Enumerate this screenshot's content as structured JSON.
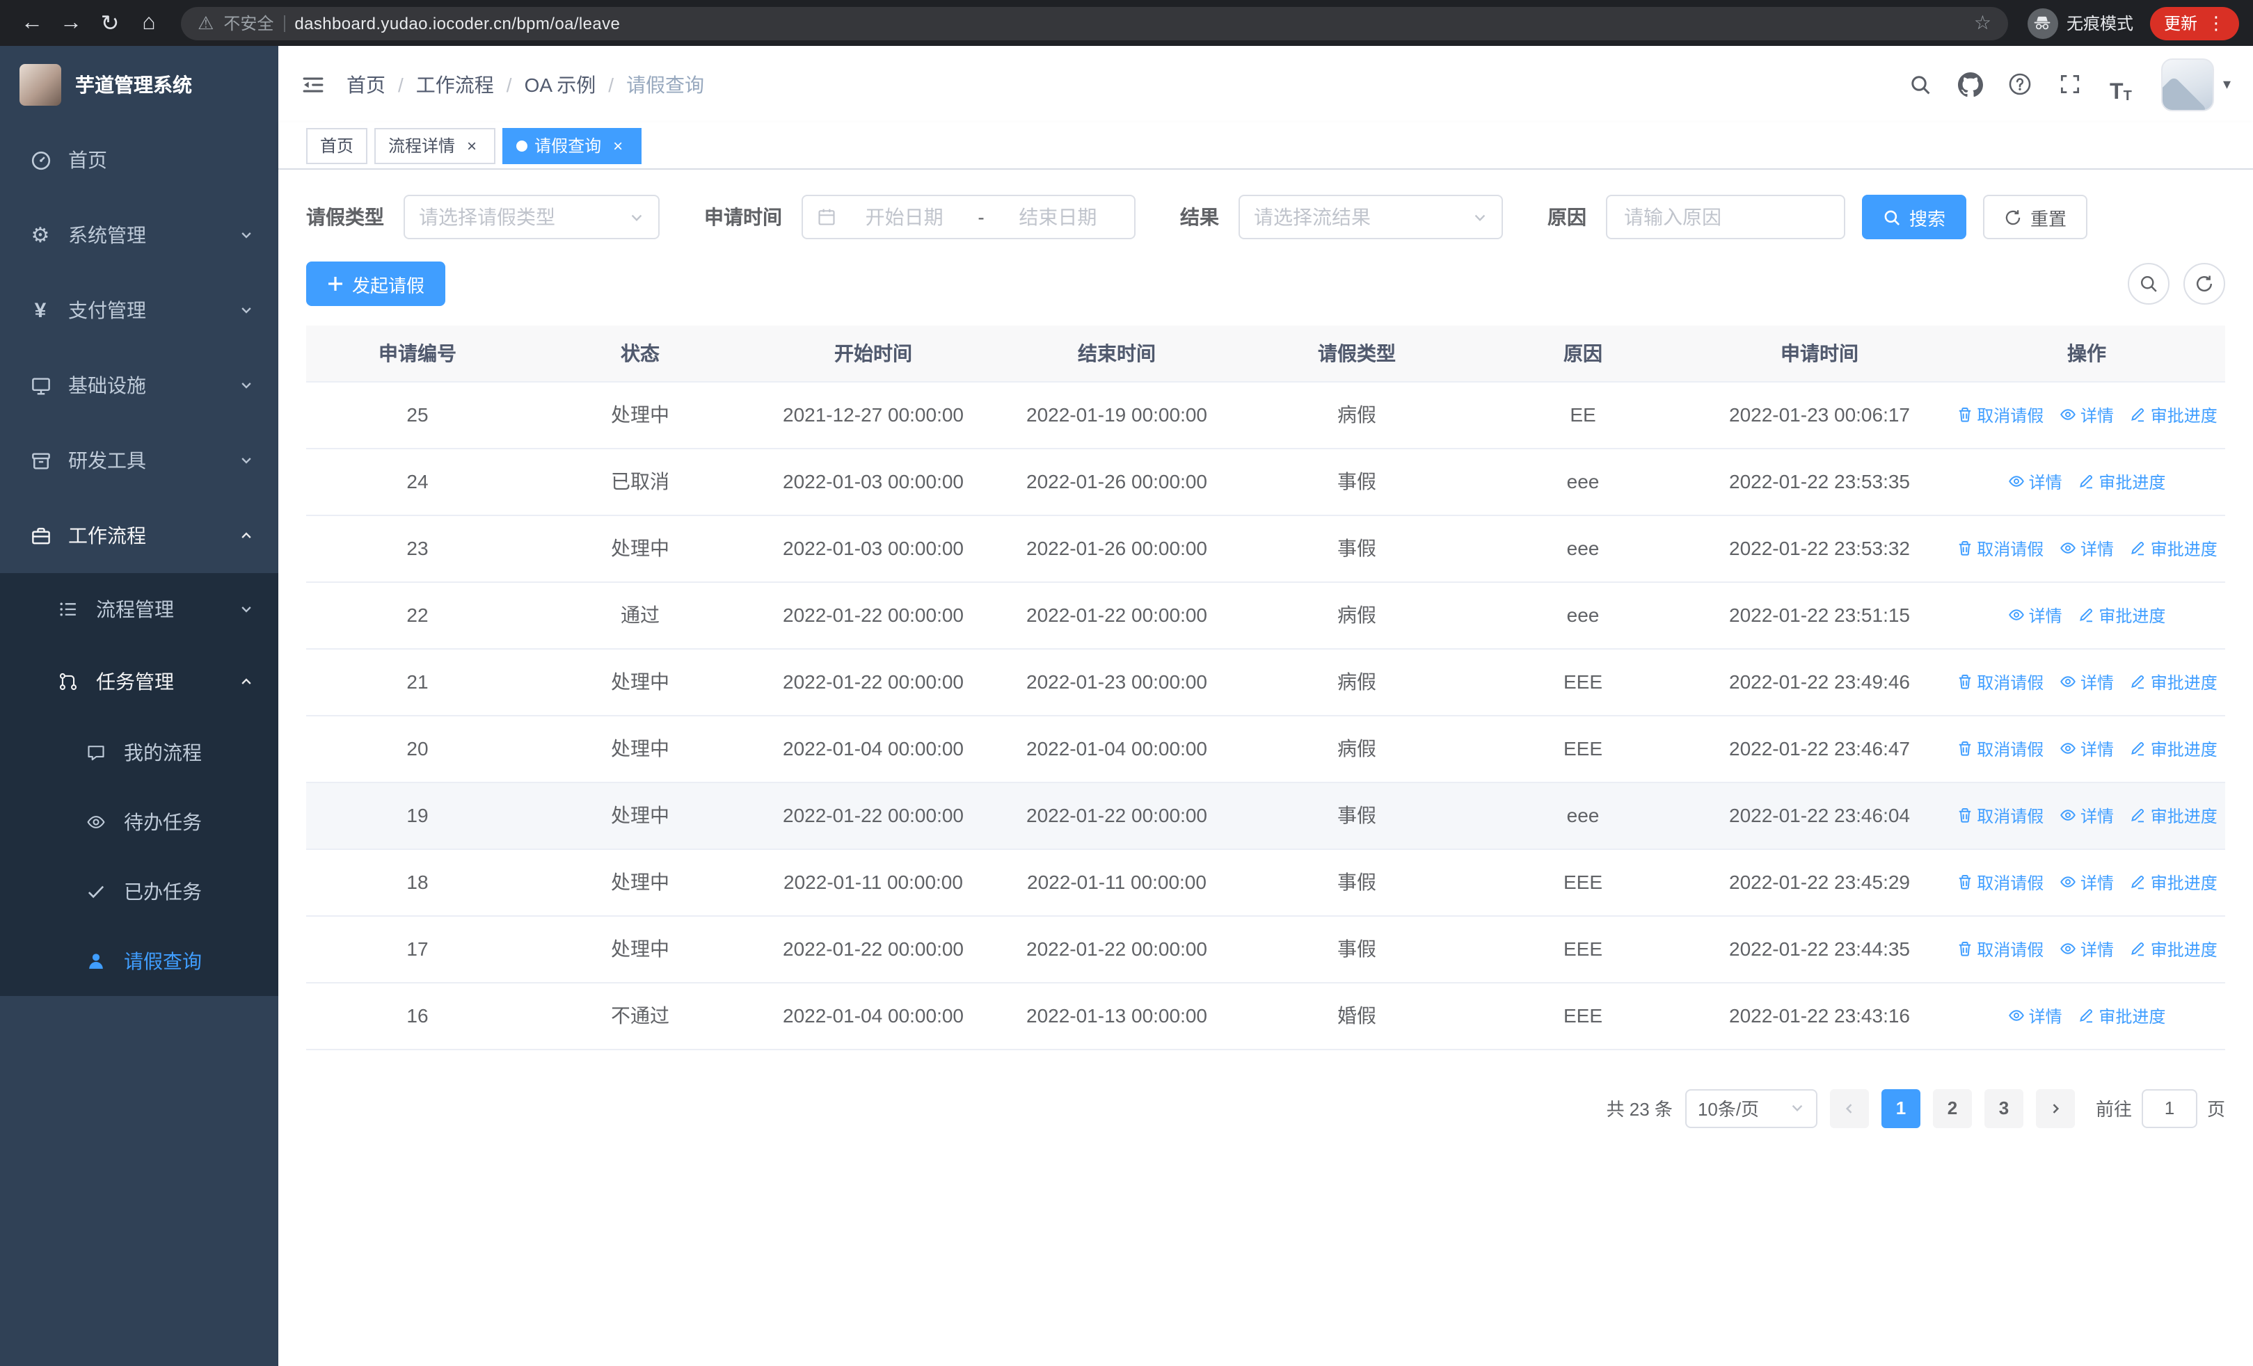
{
  "colors": {
    "primary": "#409eff",
    "sidebar_bg": "#304156",
    "submenu_bg": "#1f2d3d",
    "update_pill": "#d93025",
    "table_header_bg": "#f8f8f9"
  },
  "browser": {
    "nav_icons": [
      "back-icon",
      "forward-icon",
      "refresh-icon",
      "home-icon"
    ],
    "security_label": "不安全",
    "url": "dashboard.yudao.iocoder.cn/bpm/oa/leave",
    "incognito_label": "无痕模式",
    "update_label": "更新"
  },
  "sidebar": {
    "app_title": "芋道管理系统",
    "menu": [
      {
        "label": "首页",
        "icon": "dashboard-icon"
      },
      {
        "label": "系统管理",
        "icon": "gear-icon"
      },
      {
        "label": "支付管理",
        "icon": "payment-icon"
      },
      {
        "label": "基础设施",
        "icon": "infrastructure-icon"
      },
      {
        "label": "研发工具",
        "icon": "devtools-icon"
      },
      {
        "label": "工作流程",
        "icon": "workflow-icon"
      }
    ],
    "workflow_submenu": [
      {
        "label": "流程管理",
        "icon": "process-icon"
      },
      {
        "label": "任务管理",
        "icon": "tasks-icon"
      }
    ],
    "task_submenu": [
      {
        "label": "我的流程",
        "icon": "my-process-icon"
      },
      {
        "label": "待办任务",
        "icon": "todo-icon"
      },
      {
        "label": "已办任务",
        "icon": "done-icon"
      },
      {
        "label": "请假查询",
        "icon": "leave-query-icon"
      }
    ]
  },
  "header": {
    "breadcrumb": [
      "首页",
      "工作流程",
      "OA 示例",
      "请假查询"
    ],
    "right_icons": [
      "search-icon",
      "github-icon",
      "help-icon",
      "fullscreen-icon",
      "font-size-icon"
    ]
  },
  "tabs": [
    {
      "label": "首页",
      "closable": false,
      "active": false
    },
    {
      "label": "流程详情",
      "closable": true,
      "active": false
    },
    {
      "label": "请假查询",
      "closable": true,
      "active": true
    }
  ],
  "filters": {
    "leave_type_label": "请假类型",
    "leave_type_placeholder": "请选择请假类型",
    "apply_time_label": "申请时间",
    "date_start_placeholder": "开始日期",
    "date_separator": "-",
    "date_end_placeholder": "结束日期",
    "result_label": "结果",
    "result_placeholder": "请选择流结果",
    "reason_label": "原因",
    "reason_placeholder": "请输入原因",
    "search_label": "搜索",
    "reset_label": "重置"
  },
  "toolbar": {
    "create_label": "发起请假"
  },
  "table": {
    "columns": [
      "申请编号",
      "状态",
      "开始时间",
      "结束时间",
      "请假类型",
      "原因",
      "申请时间",
      "操作"
    ],
    "actions": {
      "cancel": "取消请假",
      "detail": "详情",
      "progress": "审批进度"
    },
    "rows": [
      {
        "id": "25",
        "status": "处理中",
        "start": "2021-12-27 00:00:00",
        "end": "2022-01-19 00:00:00",
        "type": "病假",
        "reason": "EE",
        "apply_time": "2022-01-23 00:06:17",
        "cancellable": true,
        "highlighted": false
      },
      {
        "id": "24",
        "status": "已取消",
        "start": "2022-01-03 00:00:00",
        "end": "2022-01-26 00:00:00",
        "type": "事假",
        "reason": "eee",
        "apply_time": "2022-01-22 23:53:35",
        "cancellable": false,
        "highlighted": false
      },
      {
        "id": "23",
        "status": "处理中",
        "start": "2022-01-03 00:00:00",
        "end": "2022-01-26 00:00:00",
        "type": "事假",
        "reason": "eee",
        "apply_time": "2022-01-22 23:53:32",
        "cancellable": true,
        "highlighted": false
      },
      {
        "id": "22",
        "status": "通过",
        "start": "2022-01-22 00:00:00",
        "end": "2022-01-22 00:00:00",
        "type": "病假",
        "reason": "eee",
        "apply_time": "2022-01-22 23:51:15",
        "cancellable": false,
        "highlighted": false
      },
      {
        "id": "21",
        "status": "处理中",
        "start": "2022-01-22 00:00:00",
        "end": "2022-01-23 00:00:00",
        "type": "病假",
        "reason": "EEE",
        "apply_time": "2022-01-22 23:49:46",
        "cancellable": true,
        "highlighted": false
      },
      {
        "id": "20",
        "status": "处理中",
        "start": "2022-01-04 00:00:00",
        "end": "2022-01-04 00:00:00",
        "type": "病假",
        "reason": "EEE",
        "apply_time": "2022-01-22 23:46:47",
        "cancellable": true,
        "highlighted": false
      },
      {
        "id": "19",
        "status": "处理中",
        "start": "2022-01-22 00:00:00",
        "end": "2022-01-22 00:00:00",
        "type": "事假",
        "reason": "eee",
        "apply_time": "2022-01-22 23:46:04",
        "cancellable": true,
        "highlighted": true
      },
      {
        "id": "18",
        "status": "处理中",
        "start": "2022-01-11 00:00:00",
        "end": "2022-01-11 00:00:00",
        "type": "事假",
        "reason": "EEE",
        "apply_time": "2022-01-22 23:45:29",
        "cancellable": true,
        "highlighted": false
      },
      {
        "id": "17",
        "status": "处理中",
        "start": "2022-01-22 00:00:00",
        "end": "2022-01-22 00:00:00",
        "type": "事假",
        "reason": "EEE",
        "apply_time": "2022-01-22 23:44:35",
        "cancellable": true,
        "highlighted": false
      },
      {
        "id": "16",
        "status": "不通过",
        "start": "2022-01-04 00:00:00",
        "end": "2022-01-13 00:00:00",
        "type": "婚假",
        "reason": "EEE",
        "apply_time": "2022-01-22 23:43:16",
        "cancellable": false,
        "highlighted": false
      }
    ]
  },
  "pagination": {
    "total_label": "共 23 条",
    "page_size_label": "10条/页",
    "pages": [
      "1",
      "2",
      "3"
    ],
    "active_page": "1",
    "goto_label": "前往",
    "goto_value": "1",
    "page_unit_label": "页"
  }
}
